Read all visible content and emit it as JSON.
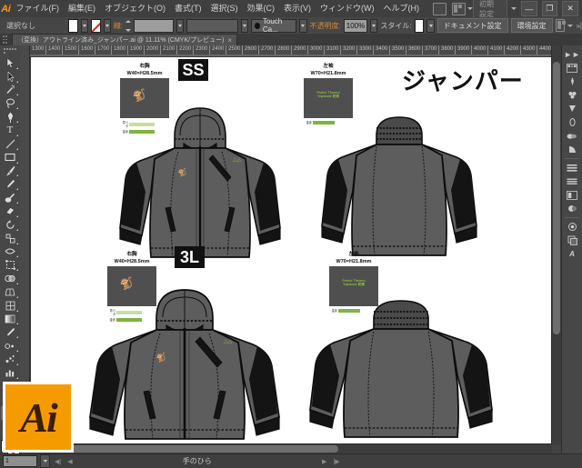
{
  "app": {
    "name": "Ai",
    "workspace": "初期設定"
  },
  "menubar": {
    "items": [
      {
        "label": "ファイル(F)"
      },
      {
        "label": "編集(E)"
      },
      {
        "label": "オブジェクト(O)"
      },
      {
        "label": "書式(T)"
      },
      {
        "label": "選択(S)"
      },
      {
        "label": "効果(C)"
      },
      {
        "label": "表示(V)"
      },
      {
        "label": "ウィンドウ(W)"
      },
      {
        "label": "ヘルプ(H)"
      }
    ],
    "window_buttons": {
      "minimize": "—",
      "maximize": "❐",
      "close": "✕"
    }
  },
  "controlbar": {
    "selection_status": "選択なし",
    "stroke_label": "線:",
    "stroke_weight": "",
    "stroke_profile": "",
    "brush_preset": "Touch Ca...",
    "opacity_label": "不透明度:",
    "opacity_value": "100%",
    "style_label": "スタイル:",
    "document_setup": "ドキュメント設定",
    "preferences": "環境設定"
  },
  "tabbar": {
    "document_title": "（変換）アウトライン済み_ジャンパー.ai @ 11.11% (CMYK/プレビュー)",
    "close_glyph": "×"
  },
  "ruler": {
    "unit_ticks": [
      "1300",
      "1400",
      "1500",
      "1600",
      "1700",
      "1800",
      "1900",
      "2000",
      "2100",
      "2200",
      "2300",
      "2400",
      "2500",
      "2600",
      "2700",
      "2800",
      "2900",
      "3000",
      "3100",
      "3200",
      "3300",
      "3400",
      "3500",
      "3600",
      "3700",
      "3800",
      "3900",
      "4000",
      "4100",
      "4200",
      "4300",
      "4400"
    ]
  },
  "toolbox": {
    "tools": [
      {
        "name": "selection-tool",
        "glyph": "↖"
      },
      {
        "name": "direct-selection-tool",
        "glyph": "↖"
      },
      {
        "name": "magic-wand-tool",
        "glyph": "✦"
      },
      {
        "name": "lasso-tool",
        "glyph": "◌"
      },
      {
        "name": "pen-tool",
        "glyph": "✒"
      },
      {
        "name": "type-tool",
        "glyph": "T"
      },
      {
        "name": "line-segment-tool",
        "glyph": "╱"
      },
      {
        "name": "rectangle-tool",
        "glyph": "▭"
      },
      {
        "name": "paintbrush-tool",
        "glyph": "✐"
      },
      {
        "name": "pencil-tool",
        "glyph": "✎"
      },
      {
        "name": "blob-brush-tool",
        "glyph": "☙"
      },
      {
        "name": "eraser-tool",
        "glyph": "▱"
      },
      {
        "name": "rotate-tool",
        "glyph": "↺"
      },
      {
        "name": "scale-tool",
        "glyph": "⛶"
      },
      {
        "name": "width-tool",
        "glyph": "⁂"
      },
      {
        "name": "free-transform-tool",
        "glyph": "⌗"
      },
      {
        "name": "shape-builder-tool",
        "glyph": "◑"
      },
      {
        "name": "perspective-grid-tool",
        "glyph": "⬚"
      },
      {
        "name": "mesh-tool",
        "glyph": "⊞"
      },
      {
        "name": "gradient-tool",
        "glyph": "▤"
      },
      {
        "name": "eyedropper-tool",
        "glyph": "⚗"
      },
      {
        "name": "blend-tool",
        "glyph": "∞"
      },
      {
        "name": "symbol-sprayer-tool",
        "glyph": "☸"
      },
      {
        "name": "column-graph-tool",
        "glyph": "█"
      },
      {
        "name": "artboard-tool",
        "glyph": "⬜"
      },
      {
        "name": "slice-tool",
        "glyph": "✂"
      },
      {
        "name": "hand-tool",
        "glyph": "✋"
      },
      {
        "name": "zoom-tool",
        "glyph": "⌕"
      }
    ]
  },
  "dock": {
    "icons": [
      {
        "name": "color-panel-icon",
        "glyph": "▦"
      },
      {
        "name": "color-guide-panel-icon",
        "glyph": "⚘"
      },
      {
        "name": "brushes-panel-icon",
        "glyph": "♣"
      },
      {
        "name": "symbols-panel-icon",
        "glyph": "◢"
      },
      {
        "name": "stroke-panel-icon",
        "glyph": "O"
      },
      {
        "name": "gradient-panel-icon",
        "glyph": "◔"
      },
      {
        "name": "transparency-panel-icon",
        "glyph": "◗"
      },
      {
        "name": "align-panel-icon",
        "glyph": "≡"
      },
      {
        "name": "pathfinder-panel-icon",
        "glyph": "⌸"
      },
      {
        "name": "transform-panel-icon",
        "glyph": "▣"
      },
      {
        "name": "appearance-panel-icon",
        "glyph": "●"
      },
      {
        "name": "graphic-styles-panel-icon",
        "glyph": "◎"
      },
      {
        "name": "layers-panel-icon",
        "glyph": "☰"
      },
      {
        "name": "links-panel-icon",
        "glyph": "A"
      }
    ]
  },
  "statusbar": {
    "artboard_number": "1",
    "current_tool": "手のひら",
    "prev_glyph": "◀",
    "next_glyph": "▶",
    "first_glyph": "◀|",
    "last_glyph": "|▶"
  },
  "artwork": {
    "title": "ジャンパー",
    "groups": [
      {
        "size_label": "SS",
        "front": {
          "spec_location": "右胸",
          "spec_dimensions": "W40×H28.5mm",
          "swatch_color": "#4f4f4f",
          "logo_color": "#8bbf3f",
          "legend": [
            {
              "key": "墨ベタ",
              "color": "#c9dca8"
            },
            {
              "key": "金赤",
              "color": "#7fb344"
            }
          ]
        },
        "back": {
          "spec_location": "左袖",
          "spec_dimensions": "W70×H21.8mm",
          "swatch_color": "#4f4f4f",
          "logo_text": "Protec Thermo Tepstude 防寒",
          "logo_color": "#8bbf3f",
          "legend": [
            {
              "key": "金赤",
              "color": "#7fb344"
            }
          ]
        }
      },
      {
        "size_label": "3L",
        "front": {
          "spec_location": "右胸",
          "spec_dimensions": "W40×H28.5mm",
          "swatch_color": "#4f4f4f",
          "logo_color": "#8bbf3f",
          "legend": [
            {
              "key": "墨ベタ",
              "color": "#c9dca8"
            },
            {
              "key": "金赤",
              "color": "#7fb344"
            }
          ]
        },
        "back": {
          "spec_location": "左袖",
          "spec_dimensions": "W70×H21.8mm",
          "swatch_color": "#4f4f4f",
          "logo_text": "Protec Thermo Tepstude 防寒",
          "logo_color": "#8bbf3f",
          "legend": [
            {
              "key": "金赤",
              "color": "#7fb344"
            }
          ]
        }
      }
    ],
    "colors": {
      "jacket_body": "#5d5d5d",
      "jacket_panel": "#141414",
      "jacket_shadow": "#4a4a4a",
      "outline": "#0d0d0d",
      "accent_green": "#8bbf3f"
    }
  }
}
